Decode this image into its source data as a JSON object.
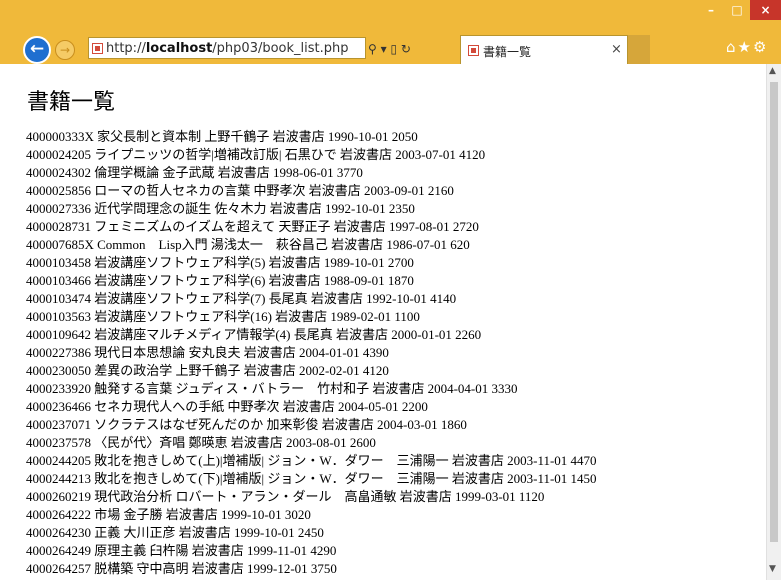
{
  "browser": {
    "window_buttons": {
      "minimize": "–",
      "maximize": "□",
      "close": "×"
    },
    "nav": {
      "back_icon": "←",
      "forward_icon": "→"
    },
    "address": {
      "prefix": "http://",
      "host": "localhost",
      "path": "/php03/book_list.php",
      "tools": "⚲ ▾ ▯ ↻"
    },
    "tab": {
      "title": "書籍一覧",
      "close": "×"
    },
    "right_icons": "⌂★⚙",
    "colors": {
      "chrome": "#f0b93a",
      "close_button": "#c7352a",
      "back_button": "#1f6fd0"
    }
  },
  "page": {
    "title": "書籍一覧",
    "books": [
      "400000333X 家父長制と資本制 上野千鶴子 岩波書店 1990-10-01 2050",
      "4000024205 ライプニッツの哲学|増補改訂版| 石黒ひで 岩波書店 2003-07-01 4120",
      "4000024302 倫理学概論 金子武蔵 岩波書店 1998-06-01 3770",
      "4000025856 ローマの哲人セネカの言葉 中野孝次 岩波書店 2003-09-01 2160",
      "4000027336 近代学問理念の誕生 佐々木力 岩波書店 1992-10-01 2350",
      "4000028731 フェミニズムのイズムを超えて 天野正子 岩波書店 1997-08-01 2720",
      "400007685X Common　Lisp入門 湯浅太一　萩谷昌己 岩波書店 1986-07-01 620",
      "4000103458 岩波講座ソフトウェア科学(5) 岩波書店 1989-10-01 2700",
      "4000103466 岩波講座ソフトウェア科学(6) 岩波書店 1988-09-01 1870",
      "4000103474 岩波講座ソフトウェア科学(7) 長尾真 岩波書店 1992-10-01 4140",
      "4000103563 岩波講座ソフトウェア科学(16) 岩波書店 1989-02-01 1100",
      "4000109642 岩波講座マルチメディア情報学(4) 長尾真 岩波書店 2000-01-01 2260",
      "4000227386 現代日本思想論 安丸良夫 岩波書店 2004-01-01 4390",
      "4000230050 差異の政治学 上野千鶴子 岩波書店 2002-02-01 4120",
      "4000233920 触発する言葉 ジュディス・バトラー　竹村和子 岩波書店 2004-04-01 3330",
      "4000236466 セネカ現代人への手紙 中野孝次 岩波書店 2004-05-01 2200",
      "4000237071 ソクラテスはなぜ死んだのか 加来彰俊 岩波書店 2004-03-01 1860",
      "4000237578 〈民が代〉斉唱 鄭暎恵 岩波書店 2003-08-01 2600",
      "4000244205 敗北を抱きしめて(上)|増補版| ジョン・W．ダワー　三浦陽一 岩波書店 2003-11-01 4470",
      "4000244213 敗北を抱きしめて(下)|増補版| ジョン・W．ダワー　三浦陽一 岩波書店 2003-11-01 1450",
      "4000260219 現代政治分析 ロバート・アラン・ダール　高畠通敏 岩波書店 1999-03-01 1120",
      "4000264222 市場 金子勝 岩波書店 1999-10-01 3020",
      "4000264230 正義 大川正彦 岩波書店 1999-10-01 2450",
      "4000264249 原理主義 臼杵陽 岩波書店 1999-11-01 4290",
      "4000264257 脱構築 守中高明 岩波書店 1999-12-01 3750"
    ]
  }
}
